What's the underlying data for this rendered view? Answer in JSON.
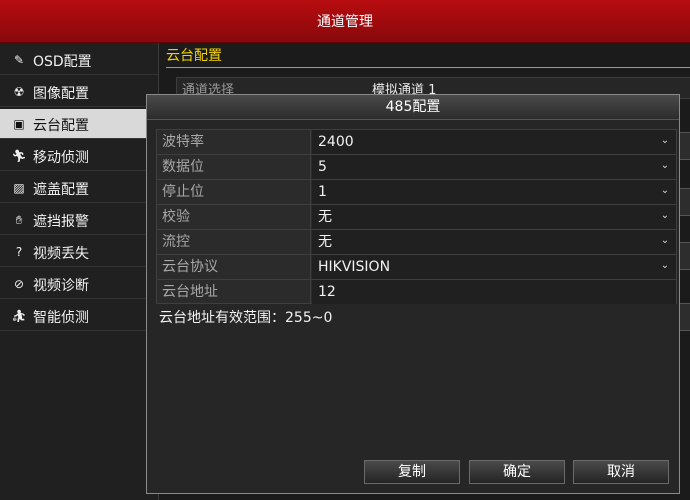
{
  "window": {
    "title": "通道管理"
  },
  "sidebar": {
    "items": [
      {
        "label": "OSD配置",
        "icon": "pen-icon",
        "active": false
      },
      {
        "label": "图像配置",
        "icon": "radiation-icon",
        "active": false
      },
      {
        "label": "云台配置",
        "icon": "ptz-icon",
        "active": true
      },
      {
        "label": "移动侦测",
        "icon": "running-man-icon",
        "active": false
      },
      {
        "label": "遮盖配置",
        "icon": "mask-icon",
        "active": false
      },
      {
        "label": "遮挡报警",
        "icon": "hand-icon",
        "active": false
      },
      {
        "label": "视频丢失",
        "icon": "question-box-icon",
        "active": false
      },
      {
        "label": "视频诊断",
        "icon": "diagnosis-icon",
        "active": false
      },
      {
        "label": "智能侦测",
        "icon": "intelligent-run-icon",
        "active": false
      }
    ]
  },
  "main": {
    "tab_label": "云台配置",
    "channel_row": {
      "label": "通道选择",
      "value": "模拟通道 1"
    }
  },
  "dialog": {
    "title": "485配置",
    "rows": [
      {
        "label": "波特率",
        "value": "2400",
        "dropdown": true
      },
      {
        "label": "数据位",
        "value": "5",
        "dropdown": true
      },
      {
        "label": "停止位",
        "value": "1",
        "dropdown": true
      },
      {
        "label": "校验",
        "value": "无",
        "dropdown": true
      },
      {
        "label": "流控",
        "value": "无",
        "dropdown": true
      },
      {
        "label": "云台协议",
        "value": "HIKVISION",
        "dropdown": true
      },
      {
        "label": "云台地址",
        "value": "12",
        "dropdown": false
      }
    ],
    "hint": "云台地址有效范围：255~0",
    "buttons": {
      "copy": "复制",
      "ok": "确定",
      "cancel": "取消"
    }
  },
  "colors": {
    "titlebar": "#a50b0e",
    "tab_accent": "#f5d400",
    "active_sidebar_bg": "#d9d9d9"
  }
}
